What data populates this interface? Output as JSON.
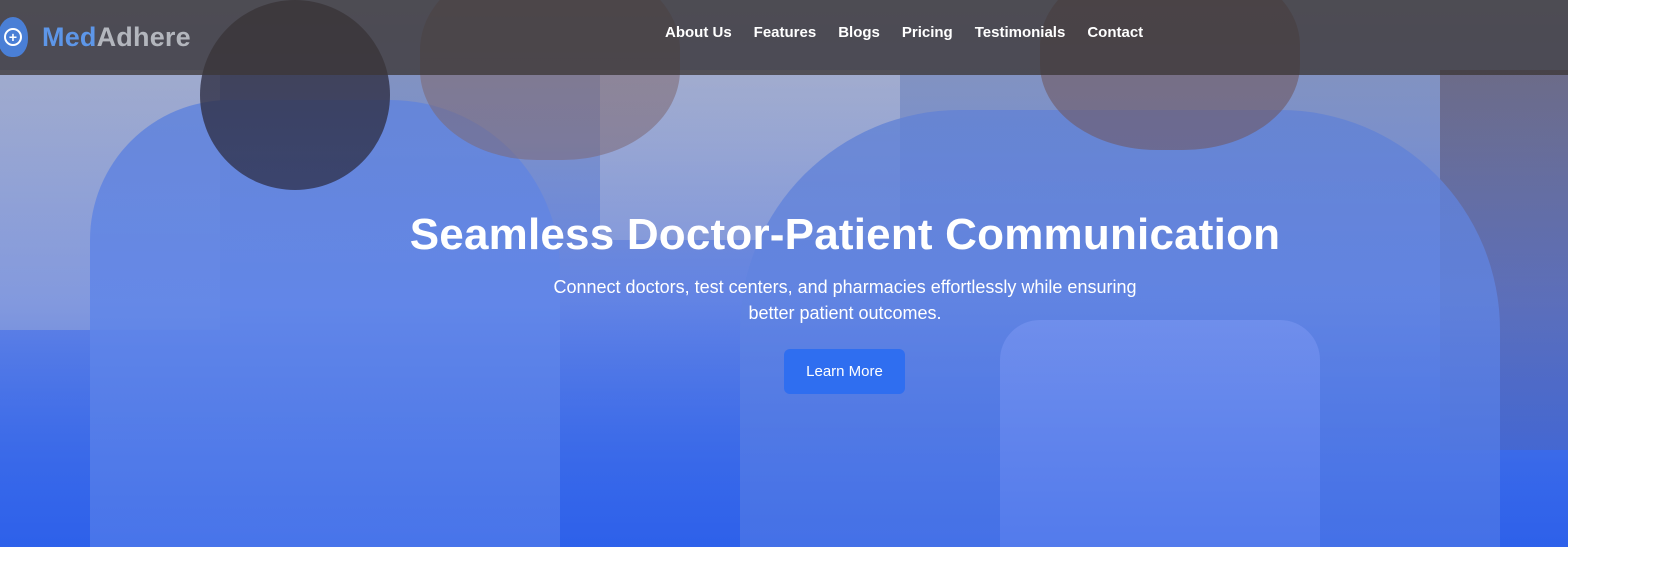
{
  "brand": {
    "name_part1": "Med",
    "name_part2": "Adhere",
    "icon": "medical-cross-icon",
    "accent": "#5d96e8"
  },
  "nav": {
    "items": [
      {
        "label": "About Us"
      },
      {
        "label": "Features"
      },
      {
        "label": "Blogs"
      },
      {
        "label": "Pricing"
      },
      {
        "label": "Testimonials"
      },
      {
        "label": "Contact"
      }
    ]
  },
  "hero": {
    "title": "Seamless Doctor-Patient Communication",
    "subtitle_line1": "Connect doctors, test centers, and pharmacies effortlessly while ensuring",
    "subtitle_line2": "better patient outcomes.",
    "cta_label": "Learn More",
    "cta_color": "#2f6ef0"
  }
}
